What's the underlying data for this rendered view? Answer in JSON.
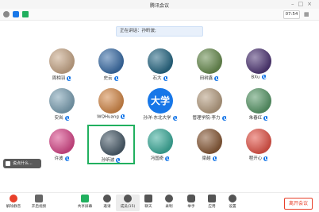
{
  "window": {
    "title": "腾讯会议"
  },
  "status": {
    "time": "07:54"
  },
  "speaking": {
    "prefix": "正在讲话：",
    "name": "孙昕波;"
  },
  "participants": [
    {
      "name": "周相羽",
      "avatar_color": "#c9a98a"
    },
    {
      "name": "史云",
      "avatar_color": "#3d6fa8"
    },
    {
      "name": "石大",
      "avatar_color": "#2a6a86"
    },
    {
      "name": "田树鑫",
      "avatar_color": "#6b8e52"
    },
    {
      "name": "BXu",
      "avatar_color": "#523a78"
    },
    {
      "name": "安岚",
      "avatar_color": "#7fa3b6"
    },
    {
      "name": "WQHuang",
      "avatar_color": "#d48a4b"
    },
    {
      "name": "孙洋-东北大学",
      "avatar_text": "大学",
      "avatar_color": "#1777e8"
    },
    {
      "name": "管理学院-李力",
      "avatar_color": "#b8a084"
    },
    {
      "name": "朱春红",
      "avatar_color": "#5b9a6b"
    },
    {
      "name": "许波",
      "avatar_color": "#d94b8c"
    },
    {
      "name": "孙昕波",
      "avatar_color": "#4b5d6b"
    },
    {
      "name": "冯国奇",
      "avatar_color": "#3fae9d"
    },
    {
      "name": "梁越",
      "avatar_color": "#8a5c3a"
    },
    {
      "name": "程开心",
      "avatar_color": "#e4574b"
    }
  ],
  "chat": {
    "placeholder": "说点什么..."
  },
  "toolbar": {
    "mute": "解除静音",
    "video": "开启视频",
    "share": "共享屏幕",
    "invite": "邀请",
    "members": "成员(15)",
    "chat": "聊天",
    "record": "录制",
    "hands": "举手",
    "apps": "应用",
    "settings": "设置",
    "leave": "离开会议"
  },
  "colors": {
    "accent": "#1777e8",
    "active_border": "#21b05f",
    "danger": "#e8402a"
  }
}
